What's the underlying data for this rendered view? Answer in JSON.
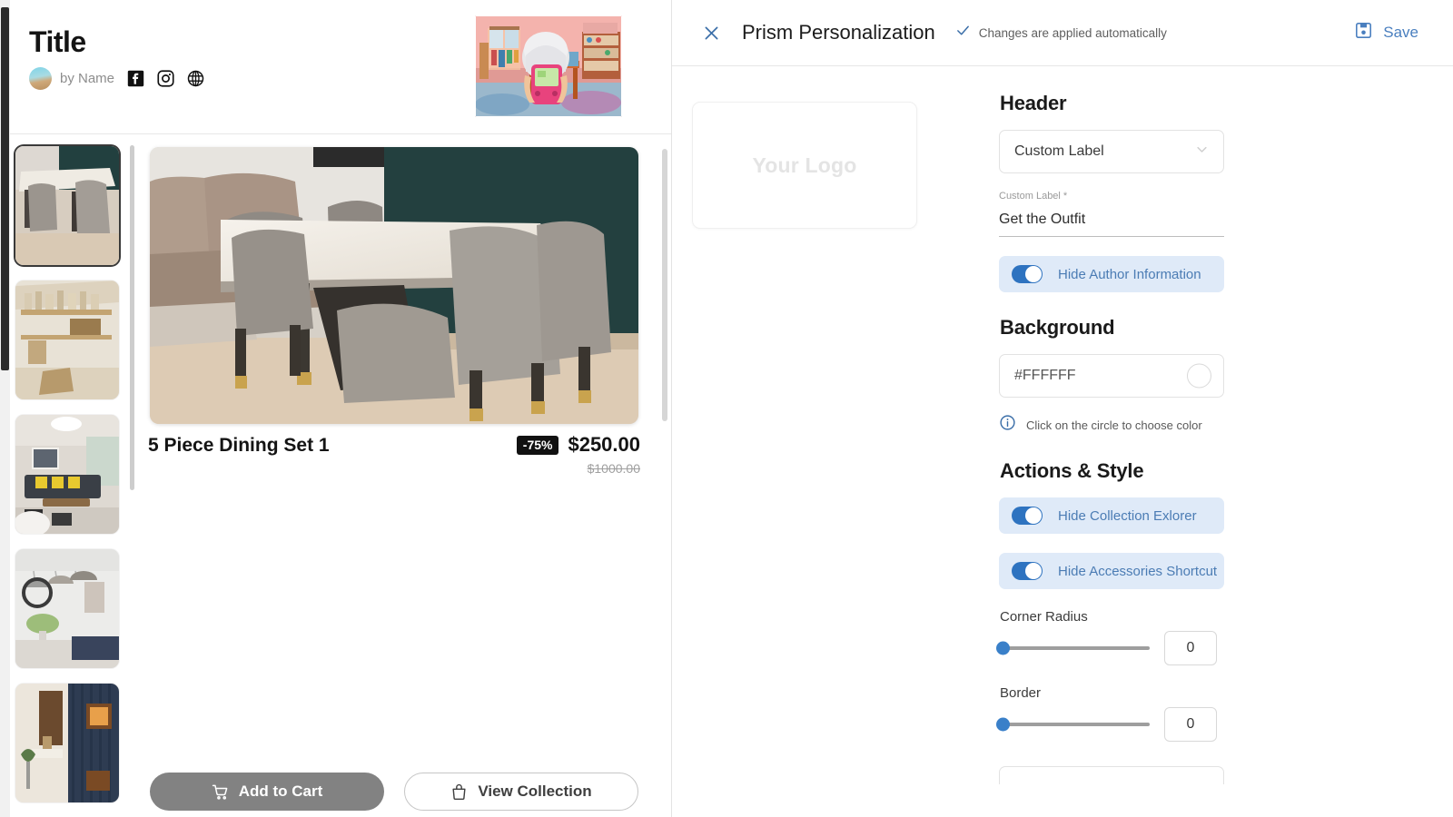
{
  "preview": {
    "title": "Title",
    "byline": "by Name",
    "social": [
      {
        "name": "facebook-icon"
      },
      {
        "name": "instagram-icon"
      },
      {
        "name": "website-icon"
      }
    ],
    "thumbnails": [
      {
        "alt": "dining-set-thumbnail",
        "selected": true
      },
      {
        "alt": "shelving-thumbnail",
        "selected": false
      },
      {
        "alt": "living-room-thumbnail",
        "selected": false
      },
      {
        "alt": "pendant-lamps-thumbnail",
        "selected": false
      },
      {
        "alt": "entryway-thumbnail",
        "selected": false
      }
    ],
    "product": {
      "name": "5 Piece Dining Set 1",
      "discount": "-75%",
      "price": "$250.00",
      "original_price": "$1000.00"
    },
    "actions": {
      "add_to_cart": "Add to Cart",
      "view_collection": "View Collection"
    }
  },
  "editor": {
    "topbar": {
      "close": "close-icon",
      "title": "Prism Personalization",
      "autosave_text": "Changes are applied automatically",
      "save_label": "Save"
    },
    "logo": {
      "placeholder": "Your Logo"
    },
    "header_section": {
      "title": "Header",
      "select_value": "Custom Label",
      "field_label": "Custom Label *",
      "field_value": "Get the Outfit",
      "toggle_label": "Hide Author Information",
      "toggle_on": true
    },
    "background_section": {
      "title": "Background",
      "color_value": "#FFFFFF",
      "hint": "Click on the circle to choose color"
    },
    "actions_section": {
      "title": "Actions & Style",
      "toggles": [
        {
          "label": "Hide Collection Exlorer",
          "on": true
        },
        {
          "label": "Hide Accessories Shortcut",
          "on": true
        }
      ],
      "sliders": [
        {
          "label": "Corner Radius",
          "value": "0"
        },
        {
          "label": "Border",
          "value": "0"
        }
      ]
    }
  },
  "colors": {
    "accent_blue": "#2e73c0",
    "toggle_bg": "#dfeaf8",
    "save_blue": "#4a7fbf",
    "badge_black": "#111111",
    "cart_gray": "#828282"
  }
}
